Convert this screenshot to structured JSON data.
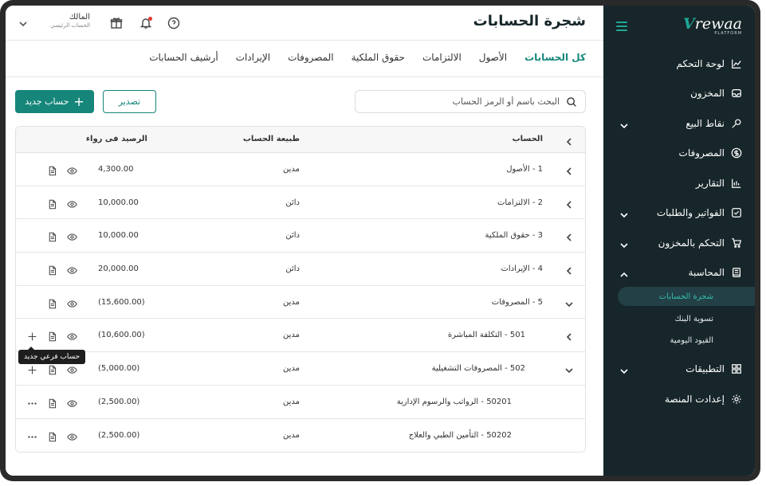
{
  "sidebar": {
    "logo_text": "rewaa",
    "logo_sub": "PLATFORM",
    "items": [
      {
        "label": "لوحة التحكم",
        "icon": "chart-line-icon"
      },
      {
        "label": "المخزون",
        "icon": "inbox-icon"
      },
      {
        "label": "نقاط البيع",
        "icon": "pos-icon"
      },
      {
        "label": "المصروفات",
        "icon": "dollar-circle-icon"
      },
      {
        "label": "التقارير",
        "icon": "bar-chart-icon"
      },
      {
        "label": "الفواتير والطلبات",
        "icon": "checkbox-icon"
      },
      {
        "label": "التحكم بالمخزون",
        "icon": "cart-icon"
      },
      {
        "label": "المحاسبة",
        "icon": "book-icon"
      },
      {
        "label": "التطبيقات",
        "icon": "grid-icon"
      },
      {
        "label": "إعدادت المنصة",
        "icon": "gear-icon"
      }
    ],
    "accounting_sub": [
      {
        "label": "شجرة الحسابات"
      },
      {
        "label": "تسوية البنك"
      },
      {
        "label": "القيود اليومية"
      }
    ]
  },
  "header": {
    "title": "شجرة الحسابات",
    "user_name": "المالك",
    "user_sub": "الحساب الرئيسي"
  },
  "tabs": [
    {
      "label": "كل الحسابات",
      "active": true
    },
    {
      "label": "الأصول"
    },
    {
      "label": "الالتزامات"
    },
    {
      "label": "حقوق الملكية"
    },
    {
      "label": "المصروفات"
    },
    {
      "label": "الإيرادات"
    },
    {
      "label": "أرشيف الحسابات"
    }
  ],
  "toolbar": {
    "search_placeholder": "البحث باسم أو الرمز الحساب",
    "export_label": "تصدير",
    "new_account_label": "حساب جديد"
  },
  "table": {
    "headers": {
      "account": "الحساب",
      "nature": "طبيعة الحساب",
      "balance": "الرصيد فى رواء"
    },
    "rows": [
      {
        "account": "1 - الأصول",
        "nature": "مدين",
        "balance": "4,300.00"
      },
      {
        "account": "2 - الالتزامات",
        "nature": "دائن",
        "balance": "10,000.00"
      },
      {
        "account": "3 - حقوق الملكية",
        "nature": "دائن",
        "balance": "10,000.00"
      },
      {
        "account": "4 - الإيرادات",
        "nature": "دائن",
        "balance": "20,000.00"
      },
      {
        "account": "5 - المصروفات",
        "nature": "مدين",
        "balance": "(15,600.00)"
      },
      {
        "account": "501 - التكلفة المباشرة",
        "nature": "مدين",
        "balance": "(10,600.00)"
      },
      {
        "account": "502 - المصروفات التشغيلية",
        "nature": "مدين",
        "balance": "(5,000.00)"
      },
      {
        "account": "50201 - الرواتب والرسوم الإدارية",
        "nature": "مدين",
        "balance": "(2,500.00)"
      },
      {
        "account": "50202 - التأمين الطبي والعلاج",
        "nature": "مدين",
        "balance": "(2,500.00)"
      }
    ]
  },
  "tooltip": {
    "text": "حساب فرعي جديد"
  },
  "colors": {
    "accent": "#16867a",
    "sidebar_bg": "#17262a"
  }
}
